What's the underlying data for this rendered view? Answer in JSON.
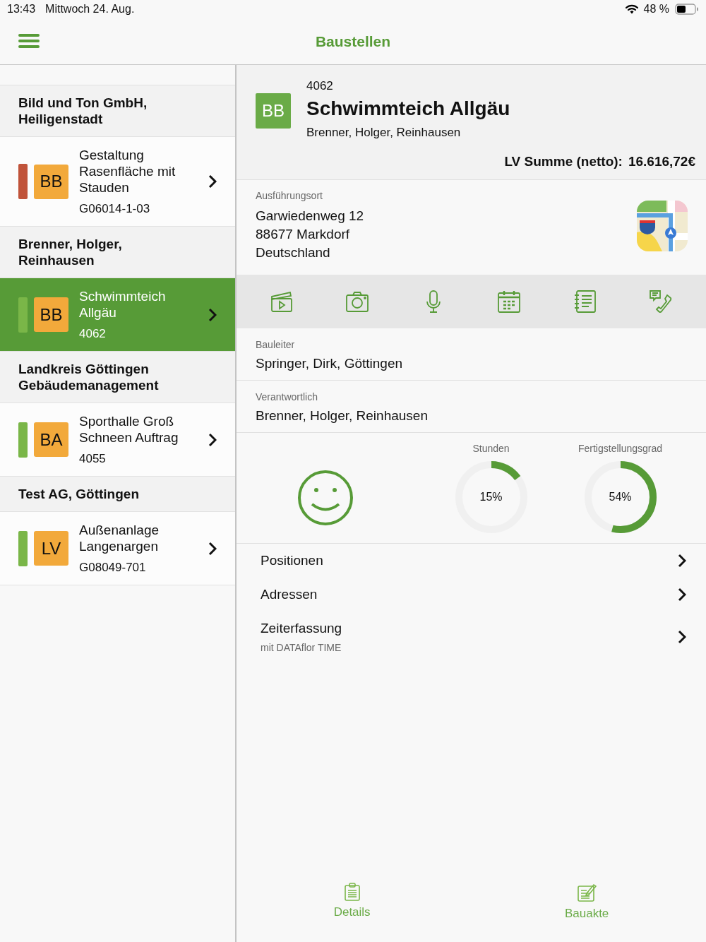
{
  "status_bar": {
    "time": "13:43",
    "date": "Mittwoch 24. Aug.",
    "battery": "48 %"
  },
  "nav_bar": {
    "title": "Baustellen"
  },
  "sidebar": {
    "groups": [
      {
        "title": "Bild und Ton GmbH, Heiligenstadt",
        "items": [
          {
            "title": "Gestaltung Rasenfläche mit Stauden",
            "badge": "BB",
            "code": "G06014-1-03",
            "color": "#c0533a",
            "selected": false
          }
        ]
      },
      {
        "title": "Brenner, Holger, Reinhausen",
        "items": [
          {
            "title": "Schwimmteich Allgäu",
            "badge": "BB",
            "code": "4062",
            "color": "#7ab648",
            "selected": true
          }
        ]
      },
      {
        "title": "Landkreis Göttingen Gebäudemanagement",
        "items": [
          {
            "title": "Sporthalle Groß Schneen Auftrag",
            "badge": "BA",
            "code": "4055",
            "color": "#7ab648",
            "selected": false
          }
        ]
      },
      {
        "title": "Test AG, Göttingen",
        "items": [
          {
            "title": "Außenanlage Langenargen",
            "badge": "LV",
            "code": "G08049-701",
            "color": "#7ab648",
            "selected": false
          }
        ]
      }
    ]
  },
  "detail": {
    "number": "4062",
    "badge": "BB",
    "title": "Schwimmteich Allgäu",
    "subtitle": "Brenner, Holger, Reinhausen",
    "sum_label": "LV Summe (netto):",
    "sum_value": "16.616,72€",
    "location": {
      "label": "Ausführungsort",
      "lines": [
        "Garwiedenweg 12",
        "88677  Markdorf",
        "Deutschland"
      ]
    },
    "fields": [
      {
        "label": "Bauleiter",
        "value": "Springer, Dirk, Göttingen"
      },
      {
        "label": "Verantwortlich",
        "value": "Brenner, Holger, Reinhausen"
      }
    ],
    "stats": [
      {
        "label": "Stunden",
        "reading": "15%",
        "level": 0.15
      },
      {
        "label": "Fertigstellungsgrad",
        "reading": "54%",
        "level": 0.54
      }
    ],
    "links": [
      {
        "title": "Positionen"
      },
      {
        "title": "Adressen"
      },
      {
        "title": "Zeiterfassung",
        "subtitle": "mit DATAflor TIME"
      }
    ]
  },
  "tab_bar": [
    {
      "label": "Details",
      "kind": "details"
    },
    {
      "label": "Bauakte",
      "kind": "file"
    }
  ]
}
